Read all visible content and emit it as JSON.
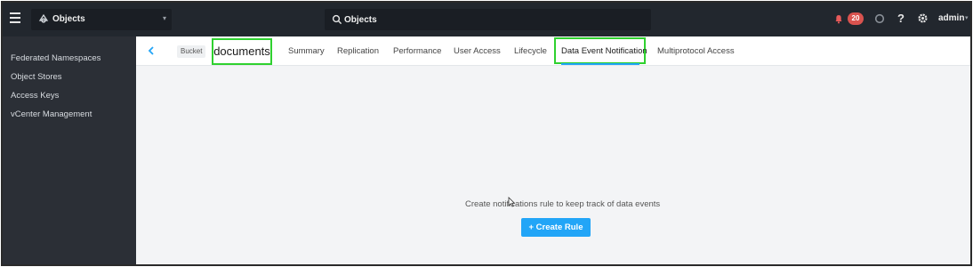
{
  "topbar": {
    "app_name": "Objects",
    "search_value": "Objects",
    "notification_count": "20",
    "help_glyph": "?",
    "user_name": "admin"
  },
  "sidebar": {
    "items": [
      {
        "label": "Federated Namespaces"
      },
      {
        "label": "Object Stores"
      },
      {
        "label": "Access Keys"
      },
      {
        "label": "vCenter Management"
      }
    ]
  },
  "header": {
    "bucket_tag": "Bucket",
    "bucket_name": "documents",
    "tabs": [
      {
        "label": "Summary"
      },
      {
        "label": "Replication"
      },
      {
        "label": "Performance"
      },
      {
        "label": "User Access"
      },
      {
        "label": "Lifecycle"
      },
      {
        "label": "Data Event Notification"
      },
      {
        "label": "Multiprotocol Access"
      }
    ],
    "active_tab": "Data Event Notification"
  },
  "main": {
    "empty_message": "Create notifications rule to keep track of data events",
    "create_button": "+ Create Rule"
  },
  "colors": {
    "accent": "#22a5f7",
    "highlight_box": "#2fd12f",
    "badge": "#d9534f",
    "topbar": "#22272e",
    "sidebar": "#2b2f36"
  },
  "icons": [
    "hamburger-icon",
    "objects-app-icon",
    "chevron-down-icon",
    "search-icon",
    "bell-icon",
    "status-circle-icon",
    "help-icon",
    "gear-icon",
    "back-chevron-icon",
    "mouse-cursor"
  ]
}
